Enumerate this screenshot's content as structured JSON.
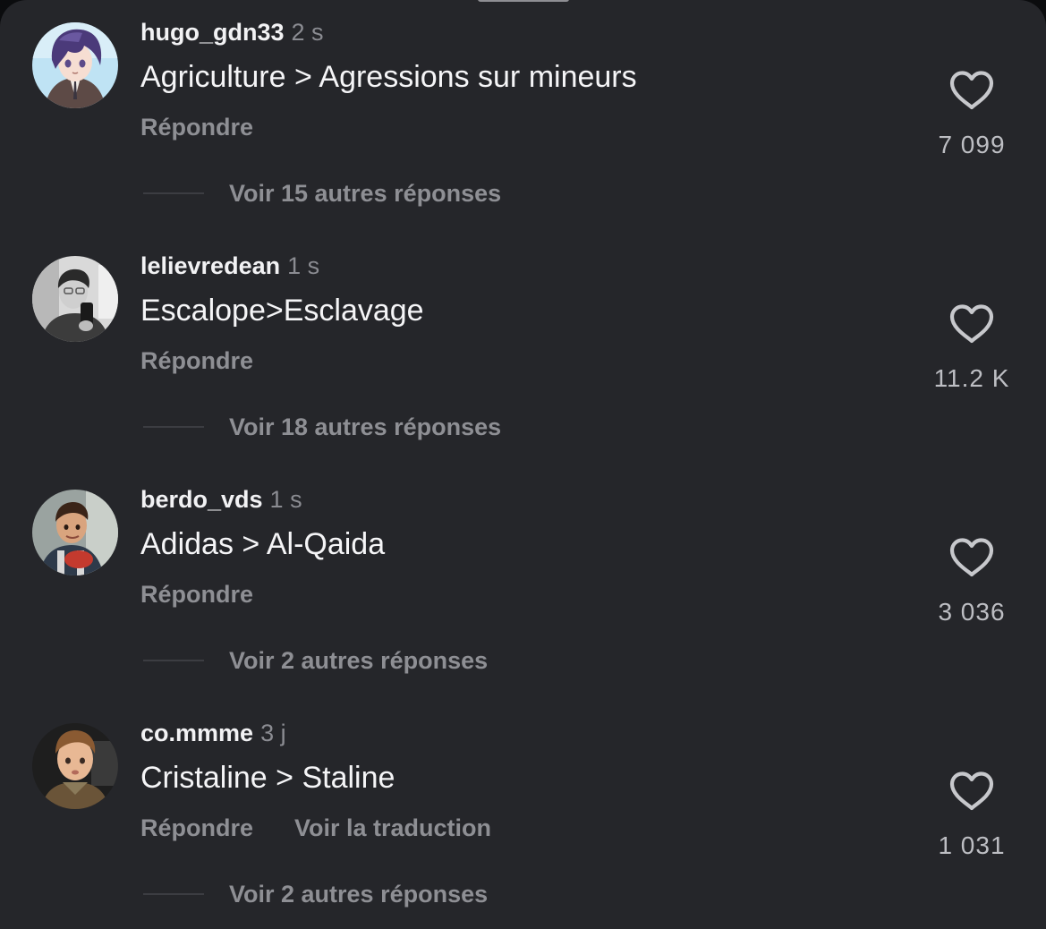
{
  "comments": [
    {
      "username": "hugo_gdn33",
      "time": "2 s",
      "text": "Agriculture > Agressions sur mineurs",
      "reply_label": "Répondre",
      "translate_label": "",
      "likes": "7 099",
      "more_replies": "Voir 15 autres réponses",
      "avatar_icon": "anime-character-avatar"
    },
    {
      "username": "lelievredean",
      "time": "1 s",
      "text": "Escalope>Esclavage",
      "reply_label": "Répondre",
      "translate_label": "",
      "likes": "11.2 K",
      "more_replies": "Voir 18 autres réponses",
      "avatar_icon": "mirror-selfie-avatar"
    },
    {
      "username": "berdo_vds",
      "time": "1 s",
      "text": "Adidas > Al-Qaida",
      "reply_label": "Répondre",
      "translate_label": "",
      "likes": "3 036",
      "more_replies": "Voir 2 autres réponses",
      "avatar_icon": "child-photo-avatar"
    },
    {
      "username": "co.mmme",
      "time": "3 j",
      "text": "Cristaline > Staline",
      "reply_label": "Répondre",
      "translate_label": "Voir la traduction",
      "likes": "1 031",
      "more_replies": "Voir 2 autres réponses",
      "avatar_icon": "child-portrait-avatar"
    }
  ],
  "colors": {
    "background": "#25262a",
    "username": "#f2f2f4",
    "secondary": "#8e8f94",
    "like_icon": "#c7c8cc"
  }
}
